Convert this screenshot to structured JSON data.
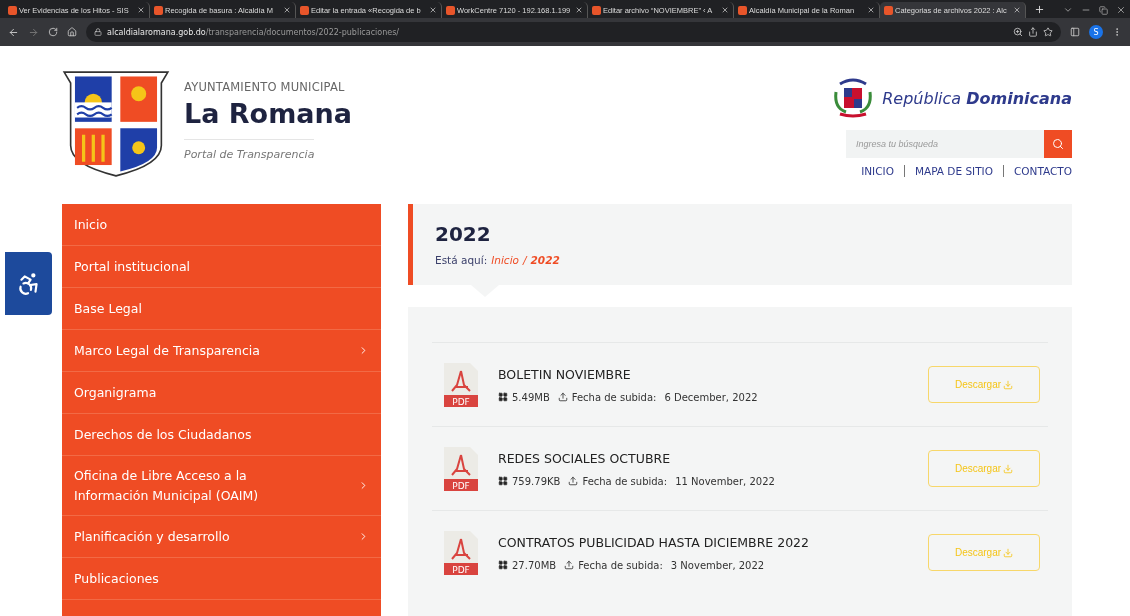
{
  "browser": {
    "tabs": [
      {
        "title": "Ver Evidencias de los Hitos - SIS",
        "selected": false
      },
      {
        "title": "Recogida de basura : Alcaldía M",
        "selected": false
      },
      {
        "title": "Editar la entrada «Recogida de b",
        "selected": false
      },
      {
        "title": "WorkCentre 7120 - 192.168.1.199",
        "selected": false
      },
      {
        "title": "Editar archivo “NOVIEMBRE” ‹ A",
        "selected": false
      },
      {
        "title": "Alcaldía Municipal de la Roman",
        "selected": false
      },
      {
        "title": "Categorias de archivos 2022 : Alc",
        "selected": true
      }
    ],
    "url_host": "alcaldialaromana.gob.do",
    "url_path": "/transparencia/documentos/2022-publicaciones/",
    "profile": "S"
  },
  "header": {
    "overline": "AYUNTAMIENTO MUNICIPAL",
    "title": "La Romana",
    "subtitle": "Portal de Transparencia",
    "republic_light": "República",
    "republic_bold": "Dominicana",
    "search_placeholder": "Ingresa tu búsqueda",
    "nav": [
      "INICIO",
      "MAPA DE SITIO",
      "CONTACTO"
    ]
  },
  "sidebar": {
    "items": [
      {
        "label": "Inicio",
        "expandable": false
      },
      {
        "label": "Portal institucional",
        "expandable": false
      },
      {
        "label": "Base Legal",
        "expandable": false
      },
      {
        "label": "Marco Legal de Transparencia",
        "expandable": true
      },
      {
        "label": "Organigrama",
        "expandable": false
      },
      {
        "label": "Derechos de los Ciudadanos",
        "expandable": false
      },
      {
        "label": "Oficina de Libre Acceso a la Información Municipal (OAIM)",
        "expandable": true
      },
      {
        "label": "Planificación y desarrollo",
        "expandable": true
      },
      {
        "label": "Publicaciones",
        "expandable": false
      }
    ]
  },
  "page": {
    "title": "2022",
    "breadcrumb_label": "Está aquí:",
    "breadcrumb": [
      "Inicio",
      "2022"
    ],
    "separator": "/"
  },
  "documents": [
    {
      "type": "PDF",
      "title": "BOLETIN NOVIEMBRE",
      "size": "5.49MB",
      "date_label": "Fecha de subida:",
      "date": "6 December, 2022",
      "button": "Descargar"
    },
    {
      "type": "PDF",
      "title": "REDES SOCIALES OCTUBRE",
      "size": "759.79KB",
      "date_label": "Fecha de subida:",
      "date": "11 November, 2022",
      "button": "Descargar"
    },
    {
      "type": "PDF",
      "title": "CONTRATOS PUBLICIDAD HASTA DICIEMBRE 2022",
      "size": "27.70MB",
      "date_label": "Fecha de subida:",
      "date": "3 November, 2022",
      "button": "Descargar"
    }
  ]
}
